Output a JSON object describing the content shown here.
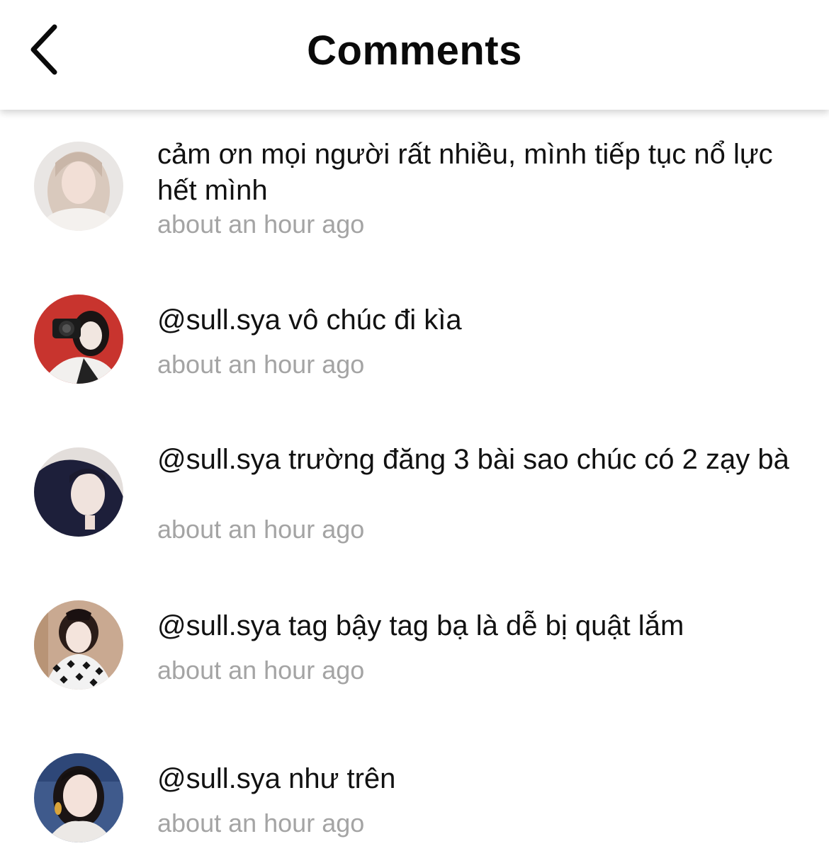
{
  "header": {
    "title": "Comments",
    "back_icon": "chevron-left-icon"
  },
  "comments": [
    {
      "text": "cảm ơn mọi người rất nhiều, mình tiếp tục nổ lực hết mình",
      "time": "about an hour ago"
    },
    {
      "text": "@sull.sya vô chúc đi kìa",
      "time": "about an hour ago"
    },
    {
      "text": "@sull.sya trường đăng 3 bài sao chúc có 2 zạy bà",
      "time": "about an hour ago"
    },
    {
      "text": "@sull.sya tag bậy tag bạ là dễ bị quật lắm",
      "time": "about an hour ago"
    },
    {
      "text": "@sull.sya như trên",
      "time": "about an hour ago"
    }
  ]
}
